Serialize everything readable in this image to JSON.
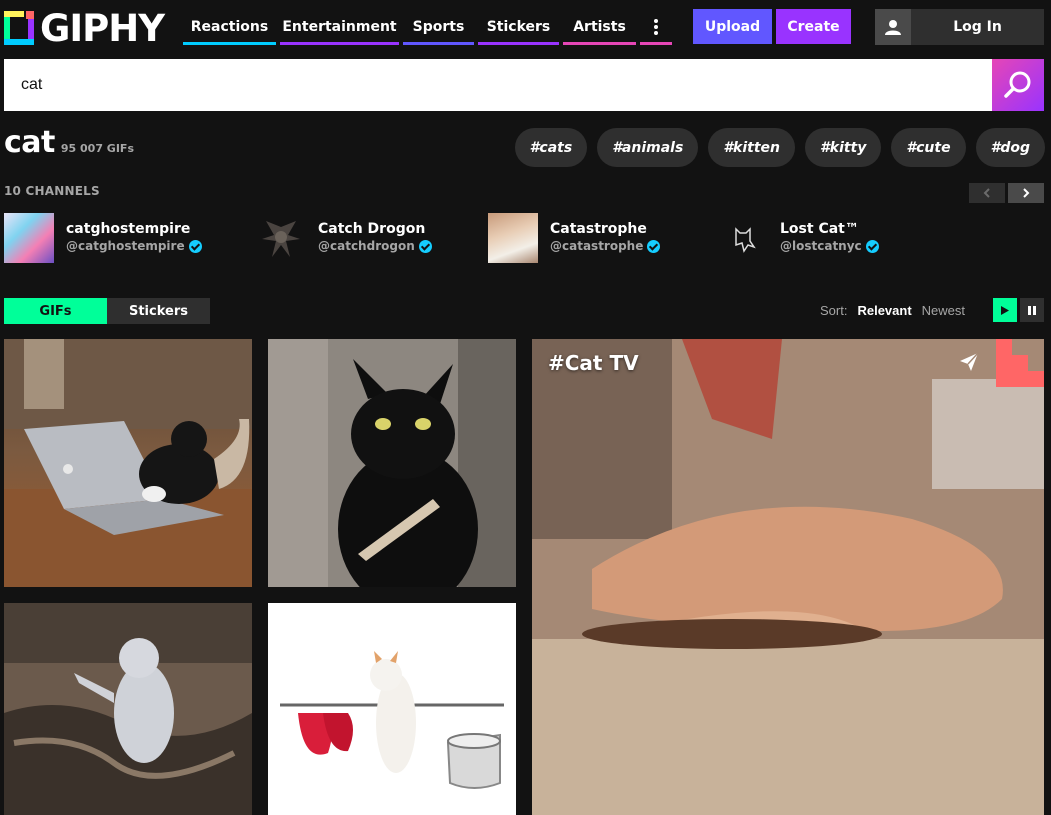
{
  "header": {
    "logo_text": "GIPHY",
    "nav": [
      {
        "label": "Reactions",
        "color": "#00ccff"
      },
      {
        "label": "Entertainment",
        "color": "#9933ff"
      },
      {
        "label": "Sports",
        "color": "#6157ff"
      },
      {
        "label": "Stickers",
        "color": "#9933ff"
      },
      {
        "label": "Artists",
        "color": "#e646b6"
      }
    ],
    "upload_label": "Upload",
    "create_label": "Create",
    "login_label": "Log In"
  },
  "search": {
    "value": "cat"
  },
  "results": {
    "title": "cat",
    "count": "95 007 GIFs",
    "tags": [
      "#cats",
      "#animals",
      "#kitten",
      "#kitty",
      "#cute",
      "#dog"
    ]
  },
  "channels": {
    "label": "10 CHANNELS",
    "items": [
      {
        "name": "catghostempire",
        "handle": "@catghostempire",
        "verified": true
      },
      {
        "name": "Catch Drogon",
        "handle": "@catchdrogon",
        "verified": true
      },
      {
        "name": "Catastrophe",
        "handle": "@catastrophe",
        "verified": true
      },
      {
        "name": "Lost Cat™",
        "handle": "@lostcatnyc",
        "verified": true
      }
    ]
  },
  "filters": {
    "gifs_label": "GIFs",
    "stickers_label": "Stickers",
    "sort_label": "Sort:",
    "sort_relevant": "Relevant",
    "sort_newest": "Newest"
  },
  "featured": {
    "title": "#Cat TV"
  },
  "colors": {
    "accent_green": "#00ff99",
    "upload": "#6157ff",
    "create": "#9933ff",
    "verified": "#15cdff",
    "background": "#121212"
  }
}
